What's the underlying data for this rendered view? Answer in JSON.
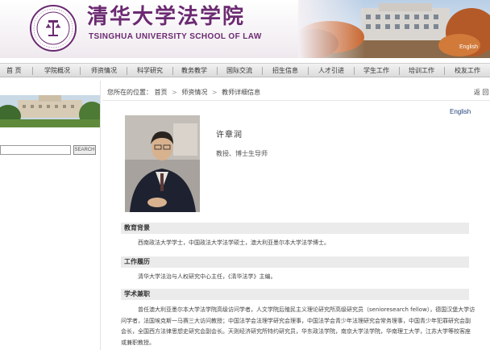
{
  "header": {
    "title_cn": "清华大学法学院",
    "title_en": "TSINGHUA UNIVERSITY SCHOOL OF LAW",
    "english_link": "English",
    "brand_color": "#6b2a71"
  },
  "nav": {
    "items": [
      "首 页",
      "学院概况",
      "师资情况",
      "科学研究",
      "教务教学",
      "国际交流",
      "招生信息",
      "人才引进",
      "学生工作",
      "培训工作",
      "校友工作"
    ]
  },
  "sidebar": {
    "search_placeholder": "",
    "search_button": "SEARCH"
  },
  "breadcrumb": {
    "prefix": "您所在的位置：",
    "items": [
      "首页",
      "师资情况",
      "教师详细信息"
    ],
    "back": "返 回"
  },
  "profile": {
    "english_link": "English",
    "name": "许章润",
    "title": "教授、博士生导师"
  },
  "sections": [
    {
      "heading": "教育背景",
      "text": "西南政法大学学士，中国政法大学法学硕士，澳大利亚墨尔本大学法学博士。"
    },
    {
      "heading": "工作履历",
      "text": "清华大学法治与人权研究中心主任，《清华法学》主编。"
    },
    {
      "heading": "学术兼职",
      "text": "曾任澳大利亚墨尔本大学法学院高级访问学者，人文学院后殖民主义理论研究所高级研究员（senioresearch fellow），德国汉堡大学访问学者，法国埃克斯一马赛三大访问教授；中国法学会法理学研究会理事，中国法学会青少年法理研究会常务理事，中国青少年犯罪研究会副会长，全国西方法律思想史研究会副会长。天则经济研究所特约研究员，华东政法学院，南京大学法学院，华南理工大学，江苏大学等校客座或兼职教授。"
    }
  ]
}
